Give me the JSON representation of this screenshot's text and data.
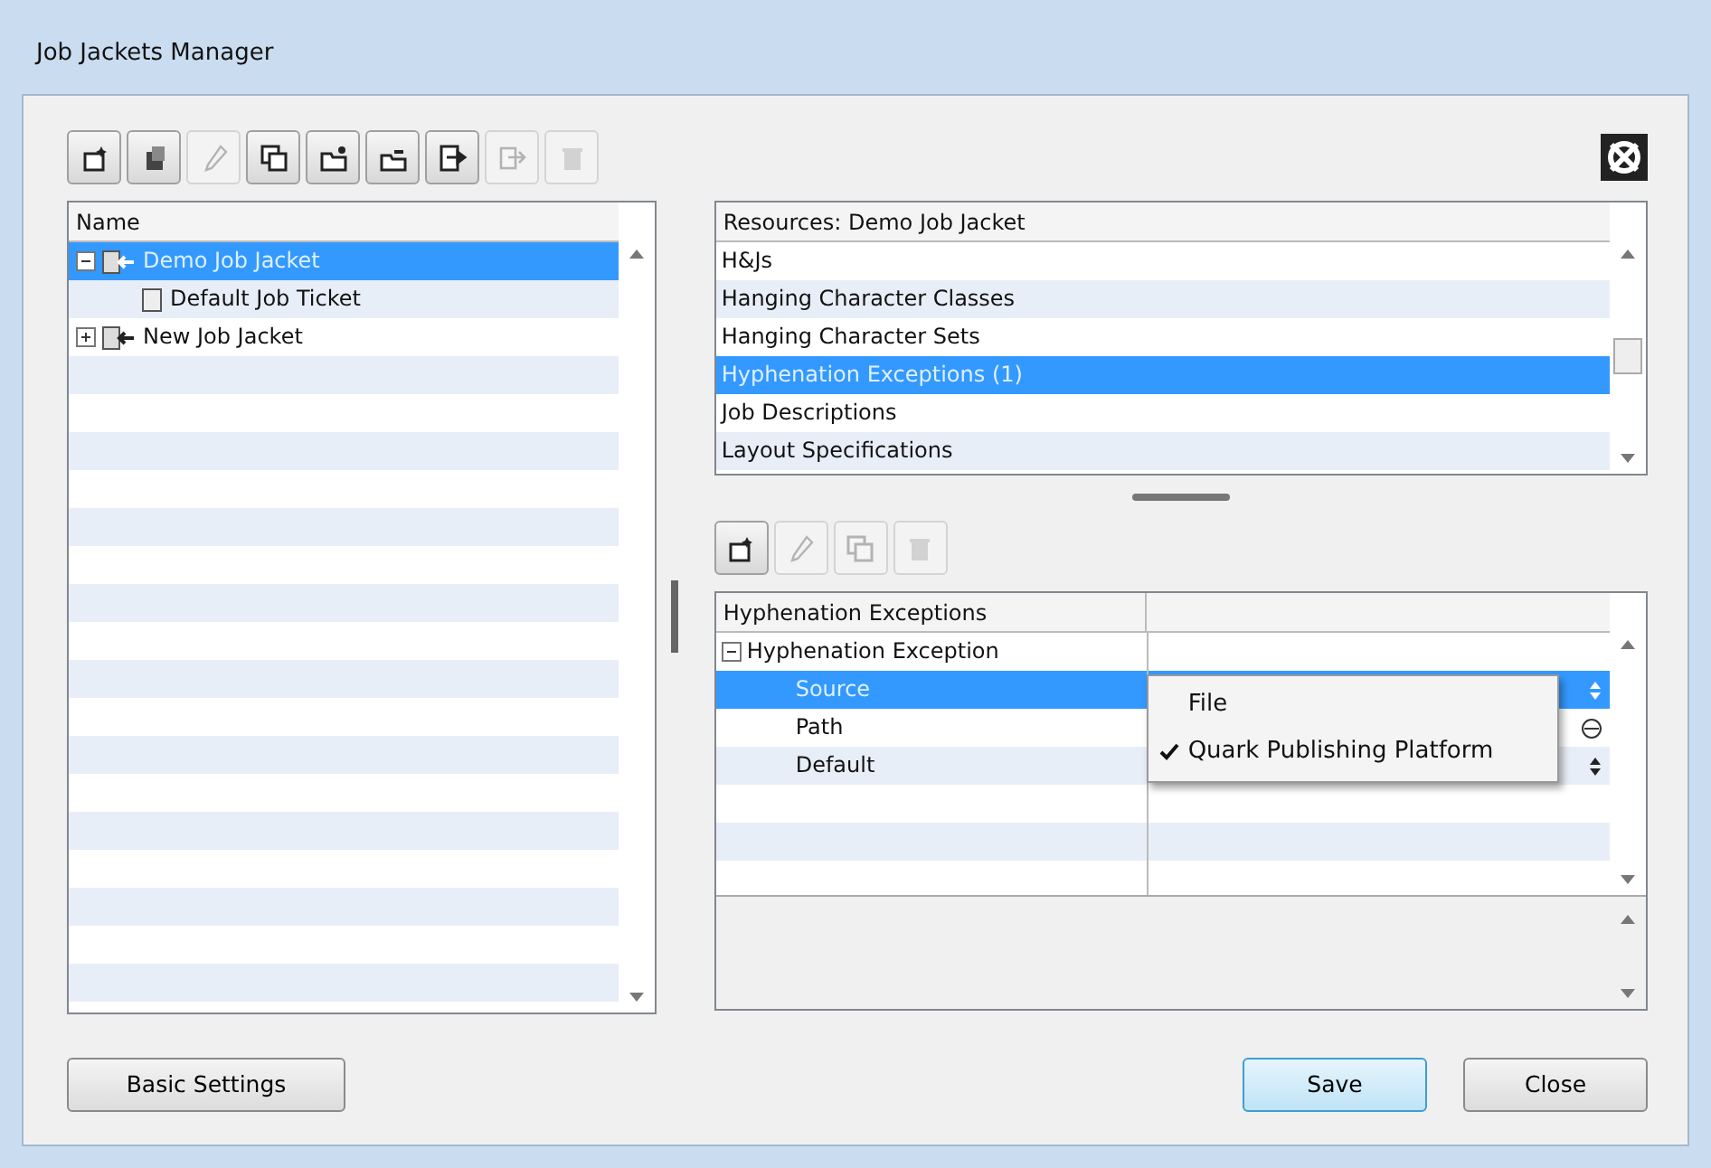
{
  "window": {
    "title": "Job Jackets Manager"
  },
  "toolbar": [
    {
      "kind": "new",
      "disabled": false
    },
    {
      "kind": "import",
      "disabled": false
    },
    {
      "kind": "edit",
      "disabled": true
    },
    {
      "kind": "duplicate",
      "disabled": false
    },
    {
      "kind": "open",
      "disabled": false
    },
    {
      "kind": "link",
      "disabled": false
    },
    {
      "kind": "export",
      "disabled": false
    },
    {
      "kind": "send",
      "disabled": true
    },
    {
      "kind": "delete",
      "disabled": true
    }
  ],
  "tree": {
    "column": "Name",
    "items": [
      {
        "label": "Demo Job Jacket",
        "kind": "jacket",
        "expanded": true,
        "selected": true,
        "children": [
          {
            "label": "Default Job Ticket",
            "kind": "ticket",
            "selected": false
          }
        ]
      },
      {
        "label": "New Job Jacket",
        "kind": "jacket",
        "expanded": false,
        "selected": false
      }
    ]
  },
  "resources": {
    "header": "Resources: Demo Job Jacket",
    "items": [
      {
        "label": "H&Js",
        "selected": false
      },
      {
        "label": "Hanging Character Classes",
        "selected": false
      },
      {
        "label": "Hanging Character Sets",
        "selected": false
      },
      {
        "label": "Hyphenation Exceptions (1)",
        "selected": true
      },
      {
        "label": "Job Descriptions",
        "selected": false
      },
      {
        "label": "Layout Specifications",
        "selected": false
      }
    ]
  },
  "item_toolbar": [
    {
      "kind": "new",
      "disabled": false
    },
    {
      "kind": "edit",
      "disabled": true
    },
    {
      "kind": "duplicate",
      "disabled": true
    },
    {
      "kind": "delete",
      "disabled": true
    }
  ],
  "properties": {
    "header": "Hyphenation Exceptions",
    "group": {
      "label": "Hyphenation Exception",
      "expanded": true,
      "rows": [
        {
          "label": "Source",
          "selected": true,
          "kind": "select"
        },
        {
          "label": "Path",
          "selected": false,
          "kind": "browse"
        },
        {
          "label": "Default",
          "selected": false,
          "kind": "select"
        }
      ]
    }
  },
  "popup_menu": [
    {
      "label": "File",
      "checked": false
    },
    {
      "label": "Quark Publishing Platform",
      "checked": true
    }
  ],
  "buttons": [
    {
      "label": "Basic Settings",
      "default": false
    },
    {
      "label": "Save",
      "default": true
    },
    {
      "label": "Close",
      "default": false
    }
  ]
}
